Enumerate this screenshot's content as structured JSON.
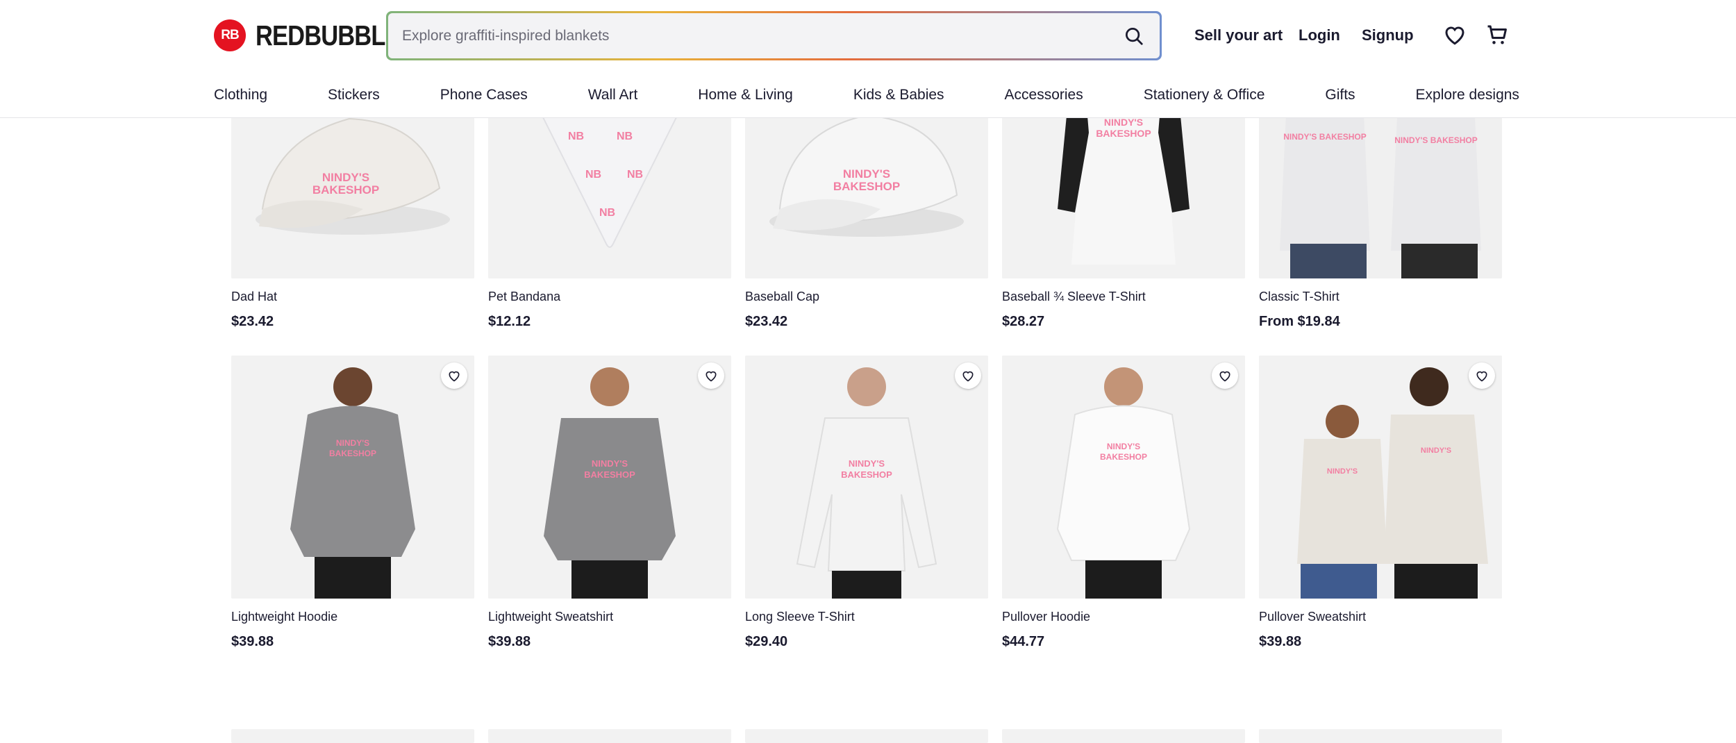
{
  "header": {
    "logo_text": "REDBUBBLE",
    "logo_mark_text": "RB",
    "search_placeholder": "Explore graffiti-inspired blankets",
    "sell_label": "Sell your art",
    "login_label": "Login",
    "signup_label": "Signup"
  },
  "nav": {
    "categories": [
      "Clothing",
      "Stickers",
      "Phone Cases",
      "Wall Art",
      "Home & Living",
      "Kids & Babies",
      "Accessories",
      "Stationery & Office",
      "Gifts",
      "Explore designs"
    ]
  },
  "colors": {
    "brand_red": "#e41321",
    "text_dark": "#1a1a2e",
    "design_pink": "#f27fa2"
  },
  "products": [
    {
      "name": "Dad Hat",
      "price": "$23.42",
      "icon": "cap"
    },
    {
      "name": "Pet Bandana",
      "price": "$12.12",
      "icon": "bandana"
    },
    {
      "name": "Baseball Cap",
      "price": "$23.42",
      "icon": "cap"
    },
    {
      "name": "Baseball ¾ Sleeve T-Shirt",
      "price": "$28.27",
      "icon": "raglan"
    },
    {
      "name": "Classic T-Shirt",
      "price": "From $19.84",
      "icon": "tshirt"
    },
    {
      "name": "Lightweight Hoodie",
      "price": "$39.88",
      "icon": "hoodie-grey"
    },
    {
      "name": "Lightweight Sweatshirt",
      "price": "$39.88",
      "icon": "sweatshirt-grey"
    },
    {
      "name": "Long Sleeve T-Shirt",
      "price": "$29.40",
      "icon": "longsleeve"
    },
    {
      "name": "Pullover Hoodie",
      "price": "$44.77",
      "icon": "hoodie-white"
    },
    {
      "name": "Pullover Sweatshirt",
      "price": "$39.88",
      "icon": "sweatshirt-cream"
    }
  ]
}
